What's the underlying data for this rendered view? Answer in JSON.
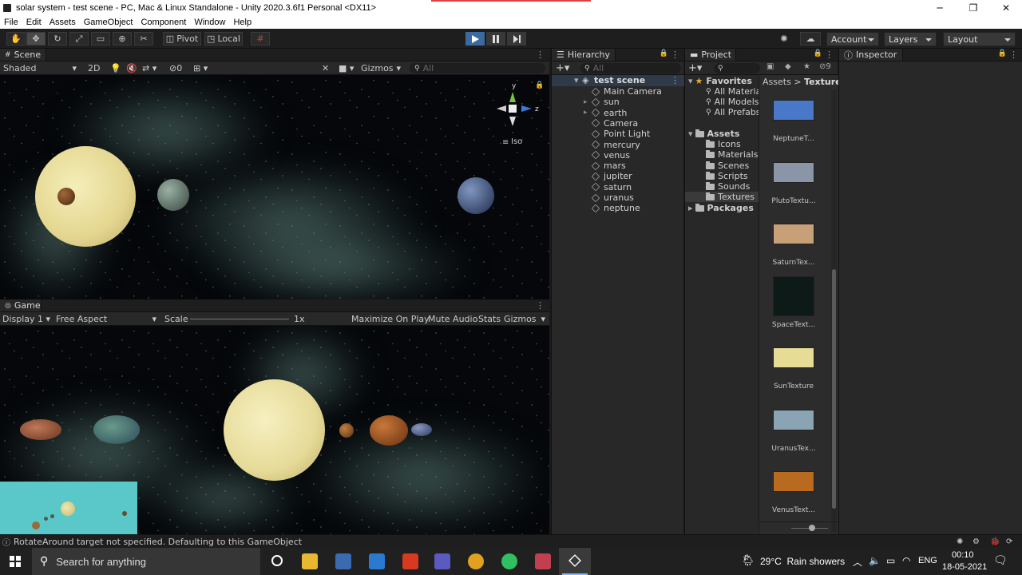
{
  "window": {
    "title": "solar system - test scene - PC, Mac & Linux Standalone - Unity 2020.3.6f1 Personal <DX11>"
  },
  "menu": [
    "File",
    "Edit",
    "Assets",
    "GameObject",
    "Component",
    "Window",
    "Help"
  ],
  "toolbar": {
    "pivot": "Pivot",
    "local": "Local",
    "account": "Account",
    "layers": "Layers",
    "layout": "Layout"
  },
  "scene": {
    "tab": "Scene",
    "shading": "Shaded",
    "mode_2d": "2D",
    "hidden_count": "0",
    "gizmos": "Gizmos",
    "search_placeholder": "All",
    "iso": "Iso",
    "axis_y": "y",
    "axis_z": "z"
  },
  "game": {
    "tab": "Game",
    "display": "Display 1",
    "aspect": "Free Aspect",
    "scale_label": "Scale",
    "scale_value": "1x",
    "maximize": "Maximize On Play",
    "mute": "Mute Audio",
    "stats": "Stats",
    "gizmos": "Gizmos"
  },
  "hierarchy": {
    "tab": "Hierarchy",
    "search_placeholder": "All",
    "scene_name": "test scene",
    "items": [
      {
        "label": "Main Camera",
        "expandable": false
      },
      {
        "label": "sun",
        "expandable": true
      },
      {
        "label": "earth",
        "expandable": true
      },
      {
        "label": "Camera",
        "expandable": false
      },
      {
        "label": "Point Light",
        "expandable": false
      },
      {
        "label": "mercury",
        "expandable": false
      },
      {
        "label": "venus",
        "expandable": false
      },
      {
        "label": "mars",
        "expandable": false
      },
      {
        "label": "jupiter",
        "expandable": false
      },
      {
        "label": "saturn",
        "expandable": false
      },
      {
        "label": "uranus",
        "expandable": false
      },
      {
        "label": "neptune",
        "expandable": false
      }
    ]
  },
  "project": {
    "tab": "Project",
    "hidden_count": "9",
    "favorites": {
      "label": "Favorites",
      "items": [
        "All Materia",
        "All Models",
        "All Prefabs"
      ]
    },
    "assets": {
      "label": "Assets",
      "items": [
        "Icons",
        "Materials",
        "Scenes",
        "Scripts",
        "Sounds",
        "Textures"
      ]
    },
    "packages": "Packages",
    "breadcrumb": {
      "root": "Assets",
      "sep": ">",
      "current": "Textures"
    },
    "thumbnails": [
      {
        "label": "NeptuneT...",
        "color": "#4a78c8"
      },
      {
        "label": "PlutoTextu...",
        "color": "#8a96a8"
      },
      {
        "label": "SaturnTex...",
        "color": "#c8a078"
      },
      {
        "label": "SpaceText...",
        "color": "#0e1a18"
      },
      {
        "label": "SunTexture",
        "color": "#e6dc96"
      },
      {
        "label": "UranusTex...",
        "color": "#8aa4b4"
      },
      {
        "label": "VenusText...",
        "color": "#b86a1e"
      }
    ]
  },
  "inspector": {
    "tab": "Inspector"
  },
  "status": {
    "message": "RotateAround target not specified. Defaulting to this GameObject"
  },
  "taskbar": {
    "search_placeholder": "Search for anything",
    "weather": "29°C  Rain showers",
    "lang": "ENG",
    "time": "00:10",
    "date": "18-05-2021"
  }
}
